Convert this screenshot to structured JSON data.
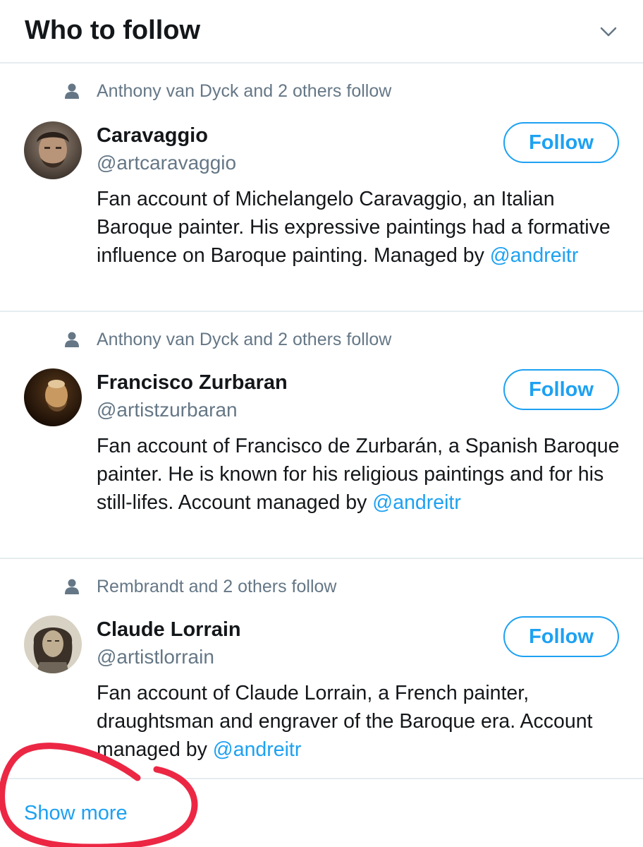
{
  "header": {
    "title": "Who to follow",
    "chevron_icon": "chevron-down-icon"
  },
  "colors": {
    "accent": "#1da1f2",
    "secondary_text": "#657786",
    "divider": "#e6ecf0",
    "annotation": "#ec2744"
  },
  "suggestions": [
    {
      "social_context": "Anthony van Dyck and 2 others follow",
      "name": "Caravaggio",
      "handle": "@artcaravaggio",
      "bio_text": "Fan account of Michelangelo Caravaggio, an Italian Baroque painter. His expressive paintings had a formative influence on Baroque painting. Managed by ",
      "bio_link": "@andreitr",
      "follow_label": "Follow"
    },
    {
      "social_context": "Anthony van Dyck and 2 others follow",
      "name": "Francisco Zurbaran",
      "handle": "@artistzurbaran",
      "bio_text": "Fan account of Francisco de Zurbarán, a Spanish Baroque painter. He is known for his religious paintings and for his still-lifes. Account managed by ",
      "bio_link": "@andreitr",
      "follow_label": "Follow"
    },
    {
      "social_context": "Rembrandt and 2 others follow",
      "name": "Claude Lorrain",
      "handle": "@artistlorrain",
      "bio_text": "Fan account of Claude Lorrain, a French painter, draughtsman and engraver of the Baroque era. Account managed by ",
      "bio_link": "@andreitr",
      "follow_label": "Follow"
    }
  ],
  "footer": {
    "show_more_label": "Show more"
  }
}
